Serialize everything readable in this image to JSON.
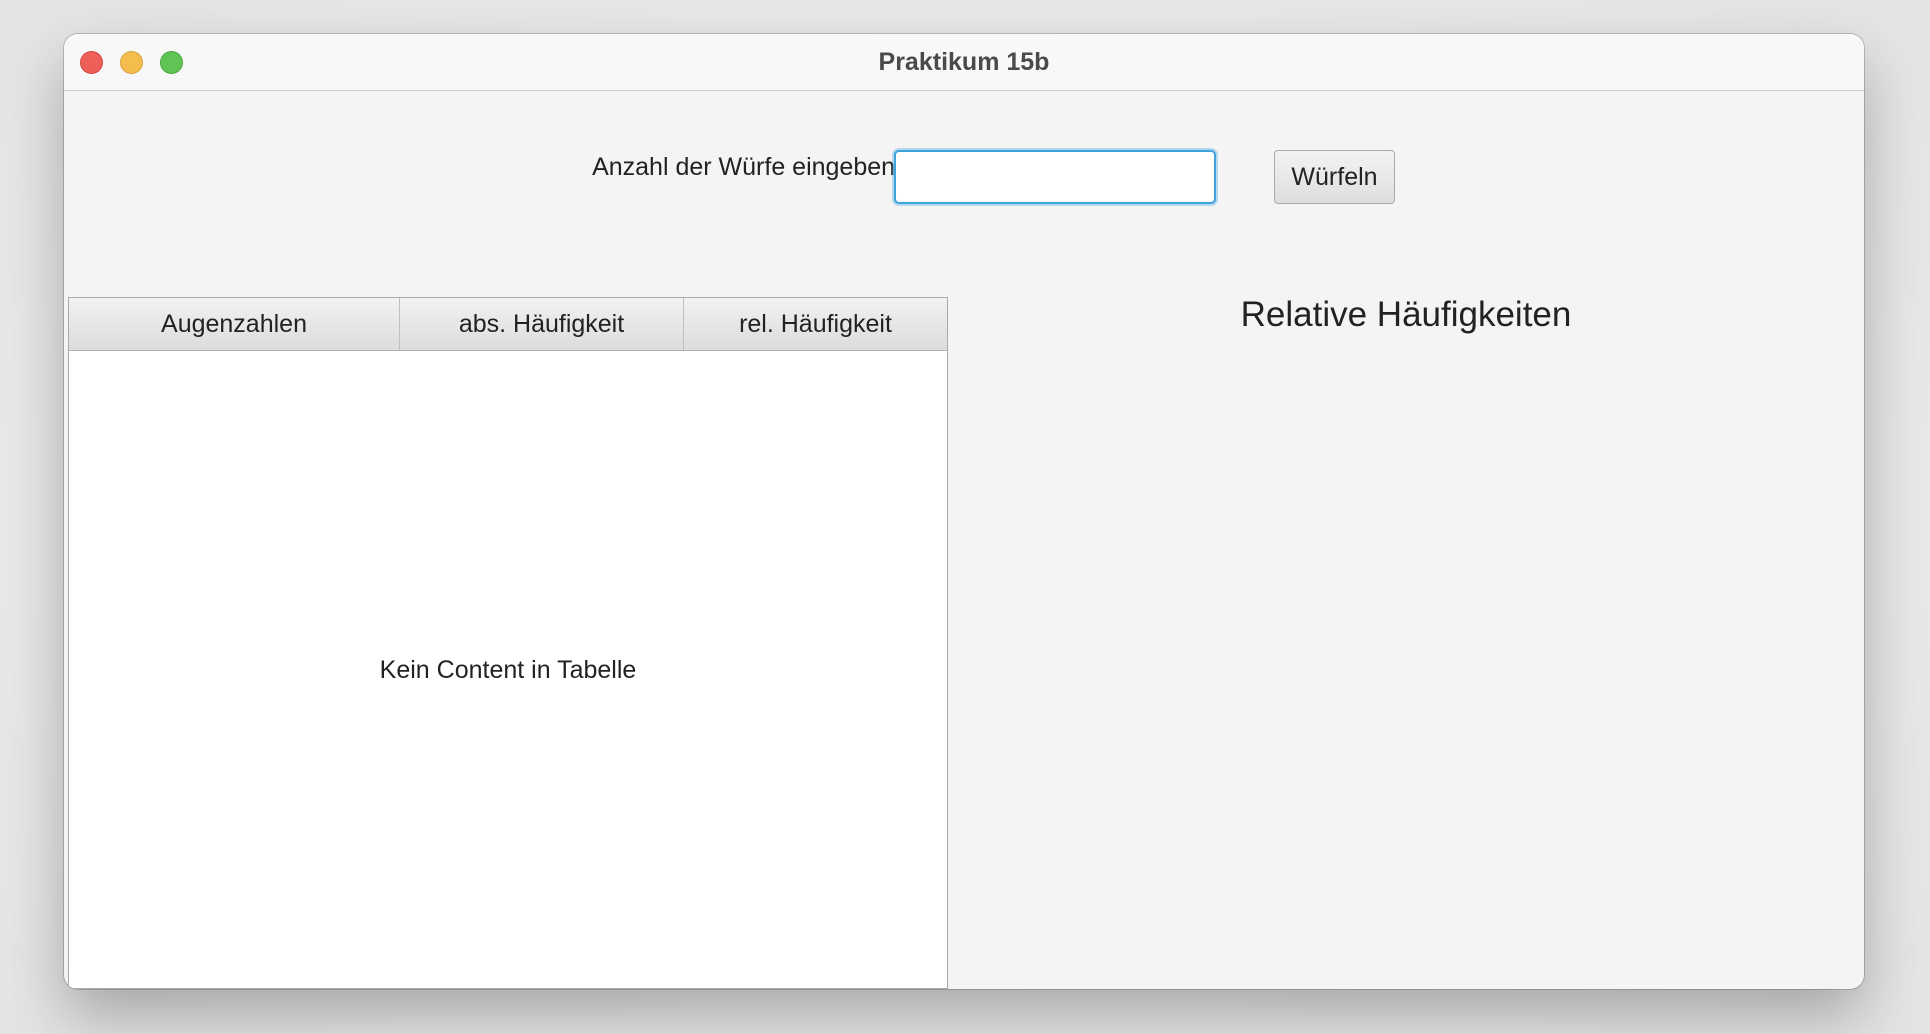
{
  "window": {
    "title": "Praktikum 15b"
  },
  "form": {
    "label": "Anzahl der Würfe eingeben:",
    "input_value": "",
    "button_label": "Würfeln"
  },
  "table": {
    "columns": [
      "Augenzahlen",
      "abs. Häufigkeit",
      "rel. Häufigkeit"
    ],
    "rows": [],
    "placeholder": "Kein Content in Tabelle"
  },
  "chart": {
    "title": "Relative Häufigkeiten"
  },
  "colors": {
    "close": "#ed5f58",
    "minimize": "#f5bd4e",
    "zoom": "#5fc453",
    "focus_ring": "#3ea2dc"
  }
}
